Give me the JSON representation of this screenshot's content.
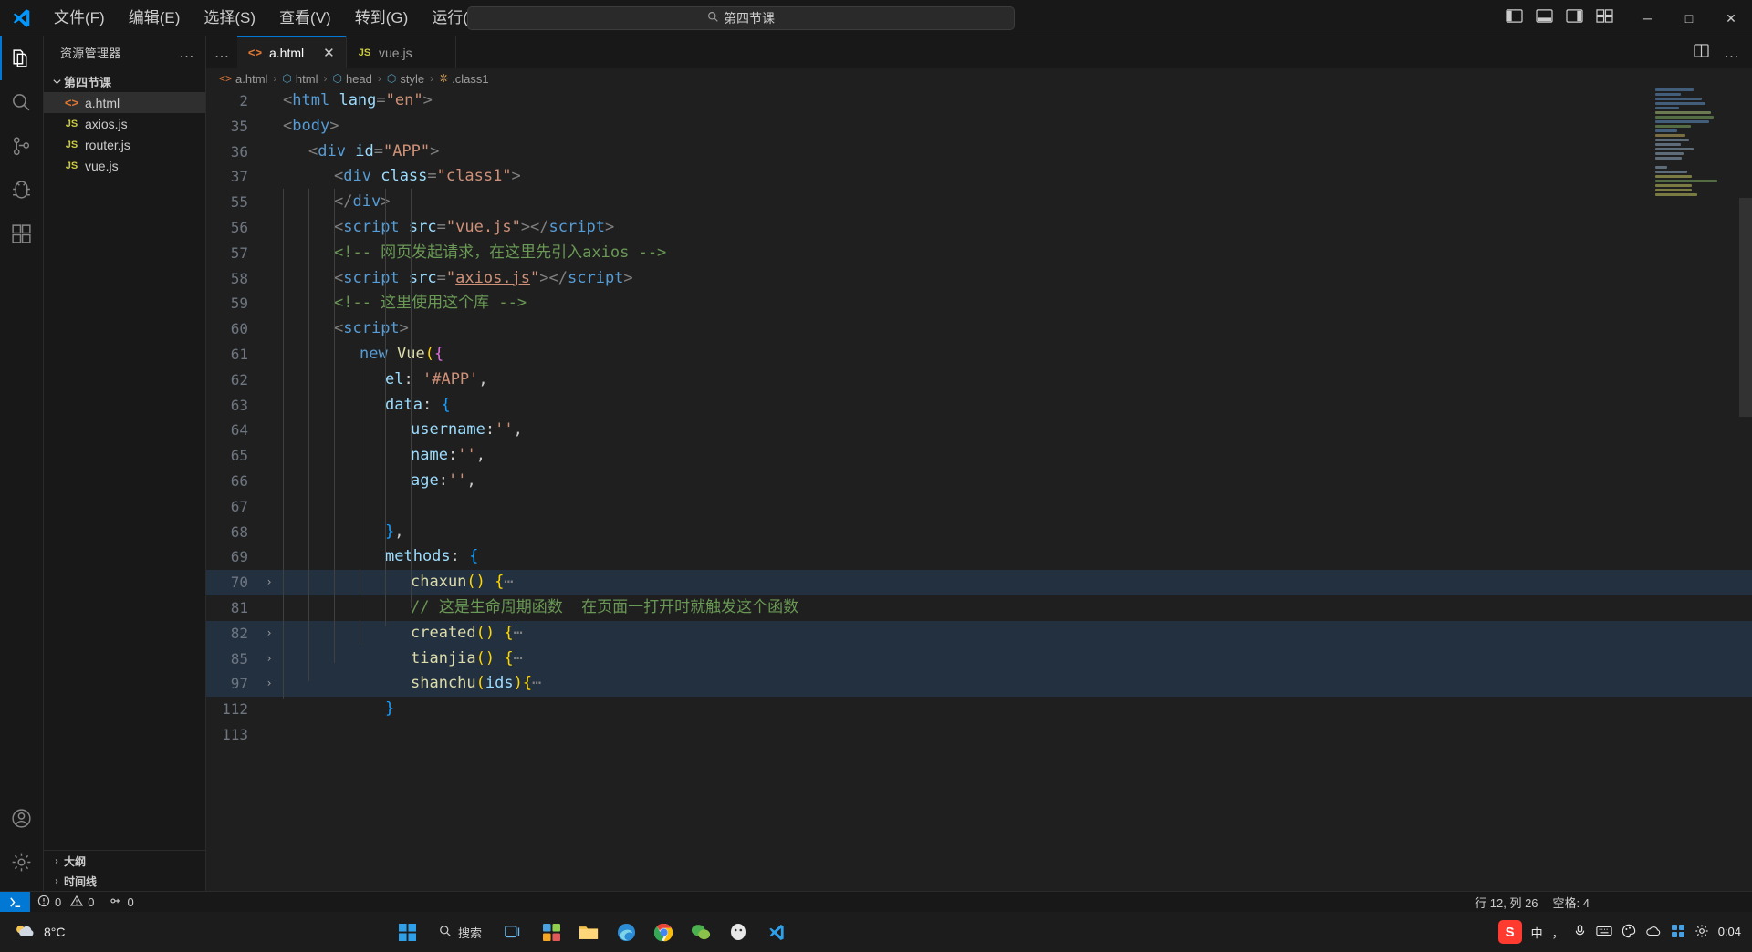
{
  "titlebar": {
    "logo": "vscode-logo",
    "menus": [
      "文件(F)",
      "编辑(E)",
      "选择(S)",
      "查看(V)",
      "转到(G)",
      "运行(R)"
    ],
    "more": "…",
    "nav_back": "‹",
    "nav_forward": "›",
    "search": {
      "icon": "search-icon",
      "value": "第四节课",
      "placeholder": "搜索"
    },
    "layout_icons": [
      "toggle-primary-sidebar-icon",
      "toggle-panel-icon",
      "toggle-secondary-sidebar-icon",
      "customize-layout-icon"
    ],
    "window_buttons": {
      "minimize": "─",
      "maximize": "□",
      "close": "✕"
    }
  },
  "activitybar": {
    "items": [
      {
        "name": "explorer",
        "icon": "files-icon",
        "active": true
      },
      {
        "name": "search",
        "icon": "search-icon",
        "active": false
      },
      {
        "name": "source-control",
        "icon": "source-control-icon",
        "active": false
      },
      {
        "name": "run-and-debug",
        "icon": "debug-icon",
        "active": false
      },
      {
        "name": "extensions",
        "icon": "extensions-icon",
        "active": false
      }
    ],
    "bottom": [
      {
        "name": "accounts",
        "icon": "account-icon"
      },
      {
        "name": "settings",
        "icon": "gear-icon"
      }
    ]
  },
  "sidebar": {
    "title": "资源管理器",
    "more": "…",
    "root": {
      "label": "第四节课",
      "expanded": true
    },
    "files": [
      {
        "label": "a.html",
        "icon": "html-file-icon",
        "icon_text": "<>",
        "selected": true
      },
      {
        "label": "axios.js",
        "icon": "js-file-icon",
        "icon_text": "JS",
        "selected": false
      },
      {
        "label": "router.js",
        "icon": "js-file-icon",
        "icon_text": "JS",
        "selected": false
      },
      {
        "label": "vue.js",
        "icon": "js-file-icon",
        "icon_text": "JS",
        "selected": false
      }
    ],
    "sections": [
      {
        "label": "大纲",
        "chevron": "›"
      },
      {
        "label": "时间线",
        "chevron": "›"
      }
    ]
  },
  "editor": {
    "tabs": [
      {
        "label": "a.html",
        "icon_text": "<>",
        "icon": "html-file-icon",
        "active": true,
        "close": "✕"
      },
      {
        "label": "vue.js",
        "icon_text": "JS",
        "icon": "js-file-icon",
        "active": false,
        "close": ""
      }
    ],
    "tab_more": "…",
    "actions": [
      "split-editor-icon",
      "more-actions-icon"
    ],
    "breadcrumb": [
      {
        "label": "a.html",
        "icon": "html-file-icon",
        "glyph": "<>"
      },
      {
        "label": "html",
        "icon": "symbol-tag-icon",
        "glyph": "⬡"
      },
      {
        "label": "head",
        "icon": "symbol-tag-icon",
        "glyph": "⬡"
      },
      {
        "label": "style",
        "icon": "symbol-tag-icon",
        "glyph": "⬡"
      },
      {
        "label": ".class1",
        "icon": "symbol-class-icon",
        "glyph": "❊"
      }
    ],
    "breadcrumb_separator": "›",
    "lines": [
      {
        "n": "2",
        "fold": "",
        "folded": false,
        "indent": 0,
        "html": "<span class='t-brk'>&lt;</span><span class='t-tag'>html</span> <span class='t-attr'>lang</span><span class='t-brk'>=</span><span class='t-str'>\"en\"</span><span class='t-brk'>&gt;</span>"
      },
      {
        "n": "35",
        "fold": "",
        "folded": false,
        "indent": 0,
        "html": "<span class='t-brk'>&lt;</span><span class='t-tag'>body</span><span class='t-brk'>&gt;</span>"
      },
      {
        "n": "36",
        "fold": "",
        "folded": false,
        "indent": 1,
        "html": "<span class='t-brk'>&lt;</span><span class='t-tag'>div</span> <span class='t-attr'>id</span><span class='t-brk'>=</span><span class='t-str'>\"APP\"</span><span class='t-brk'>&gt;</span>"
      },
      {
        "n": "37",
        "fold": "",
        "folded": false,
        "indent": 2,
        "html": "<span class='t-brk'>&lt;</span><span class='t-tag'>div</span> <span class='t-attr'>class</span><span class='t-brk'>=</span><span class='t-str'>\"class1\"</span><span class='t-brk'>&gt;</span>"
      },
      {
        "n": "55",
        "fold": "",
        "folded": false,
        "indent": 2,
        "html": "<span class='t-brk'>&lt;/</span><span class='t-tag'>div</span><span class='t-brk'>&gt;</span>"
      },
      {
        "n": "56",
        "fold": "",
        "folded": false,
        "indent": 2,
        "html": "<span class='t-brk'>&lt;</span><span class='t-tag'>script</span> <span class='t-attr'>src</span><span class='t-brk'>=</span><span class='t-str'>\"<span class='t-ul'>vue.js</span>\"</span><span class='t-brk'>&gt;&lt;/</span><span class='t-tag'>script</span><span class='t-brk'>&gt;</span>"
      },
      {
        "n": "57",
        "fold": "",
        "folded": false,
        "indent": 2,
        "html": "<span class='t-com'>&lt;!-- 网页发起请求，在这里先引入axios --&gt;</span>"
      },
      {
        "n": "58",
        "fold": "",
        "folded": false,
        "indent": 2,
        "html": "<span class='t-brk'>&lt;</span><span class='t-tag'>script</span> <span class='t-attr'>src</span><span class='t-brk'>=</span><span class='t-str'>\"<span class='t-ul'>axios.js</span>\"</span><span class='t-brk'>&gt;&lt;/</span><span class='t-tag'>script</span><span class='t-brk'>&gt;</span>"
      },
      {
        "n": "59",
        "fold": "",
        "folded": false,
        "indent": 2,
        "html": "<span class='t-com'>&lt;!-- 这里使用这个库 --&gt;</span>"
      },
      {
        "n": "60",
        "fold": "",
        "folded": false,
        "indent": 2,
        "html": "<span class='t-brk'>&lt;</span><span class='t-tag'>script</span><span class='t-brk'>&gt;</span>"
      },
      {
        "n": "61",
        "fold": "",
        "folded": false,
        "indent": 3,
        "html": "<span class='t-key'>new</span> <span class='t-fn'>Vue</span><span class='t-y'>(</span><span class='t-p'>{</span>"
      },
      {
        "n": "62",
        "fold": "",
        "folded": false,
        "indent": 4,
        "html": "<span class='t-var'>el</span><span class='t-pun'>:</span> <span class='t-str'>'#APP'</span><span class='t-pun'>,</span>"
      },
      {
        "n": "63",
        "fold": "",
        "folded": false,
        "indent": 4,
        "html": "<span class='t-var'>data</span><span class='t-pun'>:</span> <span class='t-b'>{</span>"
      },
      {
        "n": "64",
        "fold": "",
        "folded": false,
        "indent": 5,
        "html": "<span class='t-var'>username</span><span class='t-pun'>:</span><span class='t-str'>''</span><span class='t-pun'>,</span>"
      },
      {
        "n": "65",
        "fold": "",
        "folded": false,
        "indent": 5,
        "html": "<span class='t-var'>name</span><span class='t-pun'>:</span><span class='t-str'>''</span><span class='t-pun'>,</span>"
      },
      {
        "n": "66",
        "fold": "",
        "folded": false,
        "indent": 5,
        "html": "<span class='t-var'>age</span><span class='t-pun'>:</span><span class='t-str'>''</span><span class='t-pun'>,</span>"
      },
      {
        "n": "67",
        "fold": "",
        "folded": false,
        "indent": 0,
        "html": ""
      },
      {
        "n": "68",
        "fold": "",
        "folded": false,
        "indent": 4,
        "html": "<span class='t-b'>}</span><span class='t-pun'>,</span>"
      },
      {
        "n": "69",
        "fold": "",
        "folded": false,
        "indent": 4,
        "html": "<span class='t-var'>methods</span><span class='t-pun'>:</span> <span class='t-b'>{</span>"
      },
      {
        "n": "70",
        "fold": "›",
        "folded": true,
        "indent": 5,
        "html": "<span class='t-fn'>chaxun</span><span class='t-y'>()</span> <span class='t-y'>{</span><span class='t-brk'>⋯</span>"
      },
      {
        "n": "81",
        "fold": "",
        "folded": false,
        "indent": 5,
        "html": "<span class='t-com'>// 这是生命周期函数  在页面一打开时就触发这个函数</span>"
      },
      {
        "n": "82",
        "fold": "›",
        "folded": true,
        "indent": 5,
        "html": "<span class='t-fn'>created</span><span class='t-y'>()</span> <span class='t-y'>{</span><span class='t-brk'>⋯</span>"
      },
      {
        "n": "85",
        "fold": "›",
        "folded": true,
        "indent": 5,
        "html": "<span class='t-fn'>tianjia</span><span class='t-y'>()</span> <span class='t-y'>{</span><span class='t-brk'>⋯</span>"
      },
      {
        "n": "97",
        "fold": "›",
        "folded": true,
        "indent": 5,
        "html": "<span class='t-fn'>shanchu</span><span class='t-y'>(</span><span class='t-var'>ids</span><span class='t-y'>){</span><span class='t-brk'>⋯</span>"
      },
      {
        "n": "112",
        "fold": "",
        "folded": false,
        "indent": 4,
        "html": "<span class='t-b'>}</span>"
      },
      {
        "n": "113",
        "fold": "",
        "folded": false,
        "indent": 0,
        "html": ""
      }
    ]
  },
  "statusbar": {
    "remote": "remote-indicator-icon",
    "errors": {
      "icon": "error-icon",
      "count": "0"
    },
    "warnings": {
      "icon": "warning-icon",
      "count": "0"
    },
    "ports": {
      "icon": "ports-icon",
      "count": "0"
    },
    "cursor": "行 12, 列 26",
    "indent": "空格: 4"
  },
  "taskbar": {
    "weather": {
      "icon": "sun-cloud-icon",
      "temp": "8°C"
    },
    "search_placeholder": "搜索",
    "apps": [
      {
        "name": "start-button",
        "icon": "windows-icon"
      },
      {
        "name": "search-box",
        "icon": "search-icon"
      },
      {
        "name": "task-view",
        "icon": "task-view-icon"
      },
      {
        "name": "widgets",
        "icon": "widgets-icon"
      },
      {
        "name": "file-explorer",
        "icon": "folder-icon"
      },
      {
        "name": "edge-browser",
        "icon": "edge-icon"
      },
      {
        "name": "chrome-browser",
        "icon": "chrome-icon"
      },
      {
        "name": "wechat",
        "icon": "wechat-icon"
      },
      {
        "name": "qq",
        "icon": "qq-icon"
      },
      {
        "name": "vscode",
        "icon": "vscode-icon"
      }
    ],
    "tray": {
      "sogou": "S",
      "ime_mode": "中",
      "punctuation": "，",
      "mic": "mic-icon",
      "keyboard": "keyboard-icon",
      "palette": "palette-icon",
      "cloud": "cloud-icon",
      "grid": "grid-icon",
      "settings": "gear-icon",
      "time": "0:04"
    }
  }
}
